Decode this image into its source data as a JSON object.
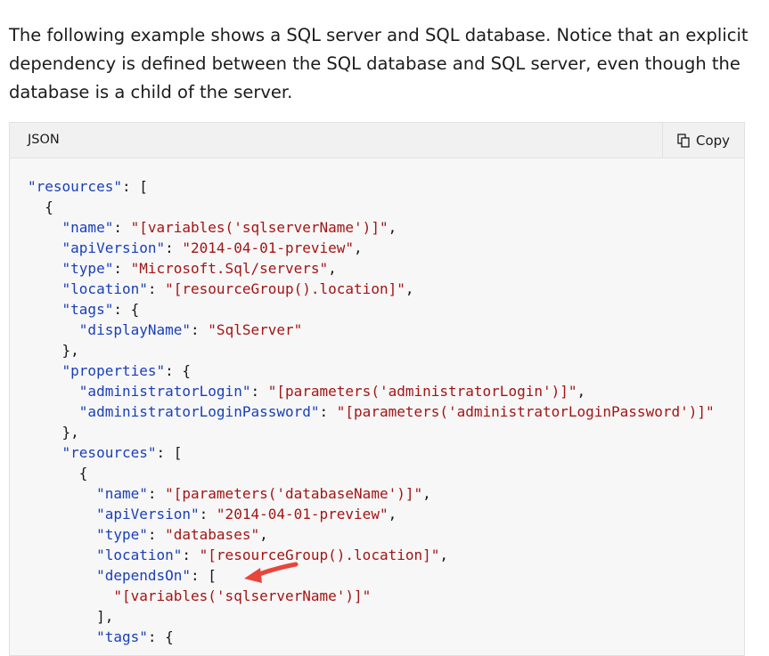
{
  "intro": "The following example shows a SQL server and SQL database. Notice that an explicit dependency is defined between the SQL database and SQL server, even though the database is a child of the server.",
  "code_header": {
    "language": "JSON",
    "copy_label": "Copy",
    "copy_icon": "copy-icon"
  },
  "code_lines": [
    [
      {
        "t": "k",
        "v": "\"resources\""
      },
      {
        "t": "p",
        "v": ": ["
      }
    ],
    [
      {
        "t": "p",
        "v": "  {"
      }
    ],
    [
      {
        "t": "p",
        "v": "    "
      },
      {
        "t": "k",
        "v": "\"name\""
      },
      {
        "t": "p",
        "v": ": "
      },
      {
        "t": "s",
        "v": "\"[variables('sqlserverName')]\""
      },
      {
        "t": "p",
        "v": ","
      }
    ],
    [
      {
        "t": "p",
        "v": "    "
      },
      {
        "t": "k",
        "v": "\"apiVersion\""
      },
      {
        "t": "p",
        "v": ": "
      },
      {
        "t": "s",
        "v": "\"2014-04-01-preview\""
      },
      {
        "t": "p",
        "v": ","
      }
    ],
    [
      {
        "t": "p",
        "v": "    "
      },
      {
        "t": "k",
        "v": "\"type\""
      },
      {
        "t": "p",
        "v": ": "
      },
      {
        "t": "s",
        "v": "\"Microsoft.Sql/servers\""
      },
      {
        "t": "p",
        "v": ","
      }
    ],
    [
      {
        "t": "p",
        "v": "    "
      },
      {
        "t": "k",
        "v": "\"location\""
      },
      {
        "t": "p",
        "v": ": "
      },
      {
        "t": "s",
        "v": "\"[resourceGroup().location]\""
      },
      {
        "t": "p",
        "v": ","
      }
    ],
    [
      {
        "t": "p",
        "v": "    "
      },
      {
        "t": "k",
        "v": "\"tags\""
      },
      {
        "t": "p",
        "v": ": {"
      }
    ],
    [
      {
        "t": "p",
        "v": "      "
      },
      {
        "t": "k",
        "v": "\"displayName\""
      },
      {
        "t": "p",
        "v": ": "
      },
      {
        "t": "s",
        "v": "\"SqlServer\""
      }
    ],
    [
      {
        "t": "p",
        "v": "    },"
      }
    ],
    [
      {
        "t": "p",
        "v": "    "
      },
      {
        "t": "k",
        "v": "\"properties\""
      },
      {
        "t": "p",
        "v": ": {"
      }
    ],
    [
      {
        "t": "p",
        "v": "      "
      },
      {
        "t": "k",
        "v": "\"administratorLogin\""
      },
      {
        "t": "p",
        "v": ": "
      },
      {
        "t": "s",
        "v": "\"[parameters('administratorLogin')]\""
      },
      {
        "t": "p",
        "v": ","
      }
    ],
    [
      {
        "t": "p",
        "v": "      "
      },
      {
        "t": "k",
        "v": "\"administratorLoginPassword\""
      },
      {
        "t": "p",
        "v": ": "
      },
      {
        "t": "s",
        "v": "\"[parameters('administratorLoginPassword')]\""
      }
    ],
    [
      {
        "t": "p",
        "v": "    },"
      }
    ],
    [
      {
        "t": "p",
        "v": "    "
      },
      {
        "t": "k",
        "v": "\"resources\""
      },
      {
        "t": "p",
        "v": ": ["
      }
    ],
    [
      {
        "t": "p",
        "v": "      {"
      }
    ],
    [
      {
        "t": "p",
        "v": "        "
      },
      {
        "t": "k",
        "v": "\"name\""
      },
      {
        "t": "p",
        "v": ": "
      },
      {
        "t": "s",
        "v": "\"[parameters('databaseName')]\""
      },
      {
        "t": "p",
        "v": ","
      }
    ],
    [
      {
        "t": "p",
        "v": "        "
      },
      {
        "t": "k",
        "v": "\"apiVersion\""
      },
      {
        "t": "p",
        "v": ": "
      },
      {
        "t": "s",
        "v": "\"2014-04-01-preview\""
      },
      {
        "t": "p",
        "v": ","
      }
    ],
    [
      {
        "t": "p",
        "v": "        "
      },
      {
        "t": "k",
        "v": "\"type\""
      },
      {
        "t": "p",
        "v": ": "
      },
      {
        "t": "s",
        "v": "\"databases\""
      },
      {
        "t": "p",
        "v": ","
      }
    ],
    [
      {
        "t": "p",
        "v": "        "
      },
      {
        "t": "k",
        "v": "\"location\""
      },
      {
        "t": "p",
        "v": ": "
      },
      {
        "t": "s",
        "v": "\"[resourceGroup().location]\""
      },
      {
        "t": "p",
        "v": ","
      }
    ],
    [
      {
        "t": "p",
        "v": "        "
      },
      {
        "t": "k",
        "v": "\"dependsOn\""
      },
      {
        "t": "p",
        "v": ": ["
      }
    ],
    [
      {
        "t": "p",
        "v": "          "
      },
      {
        "t": "s",
        "v": "\"[variables('sqlserverName')]\""
      }
    ],
    [
      {
        "t": "p",
        "v": "        ],"
      }
    ],
    [
      {
        "t": "p",
        "v": "        "
      },
      {
        "t": "k",
        "v": "\"tags\""
      },
      {
        "t": "p",
        "v": ": {"
      }
    ]
  ],
  "colors": {
    "key": "#1a3fb8",
    "string": "#a31515",
    "punctuation": "#171717",
    "annotation_arrow": "#e8453c"
  }
}
